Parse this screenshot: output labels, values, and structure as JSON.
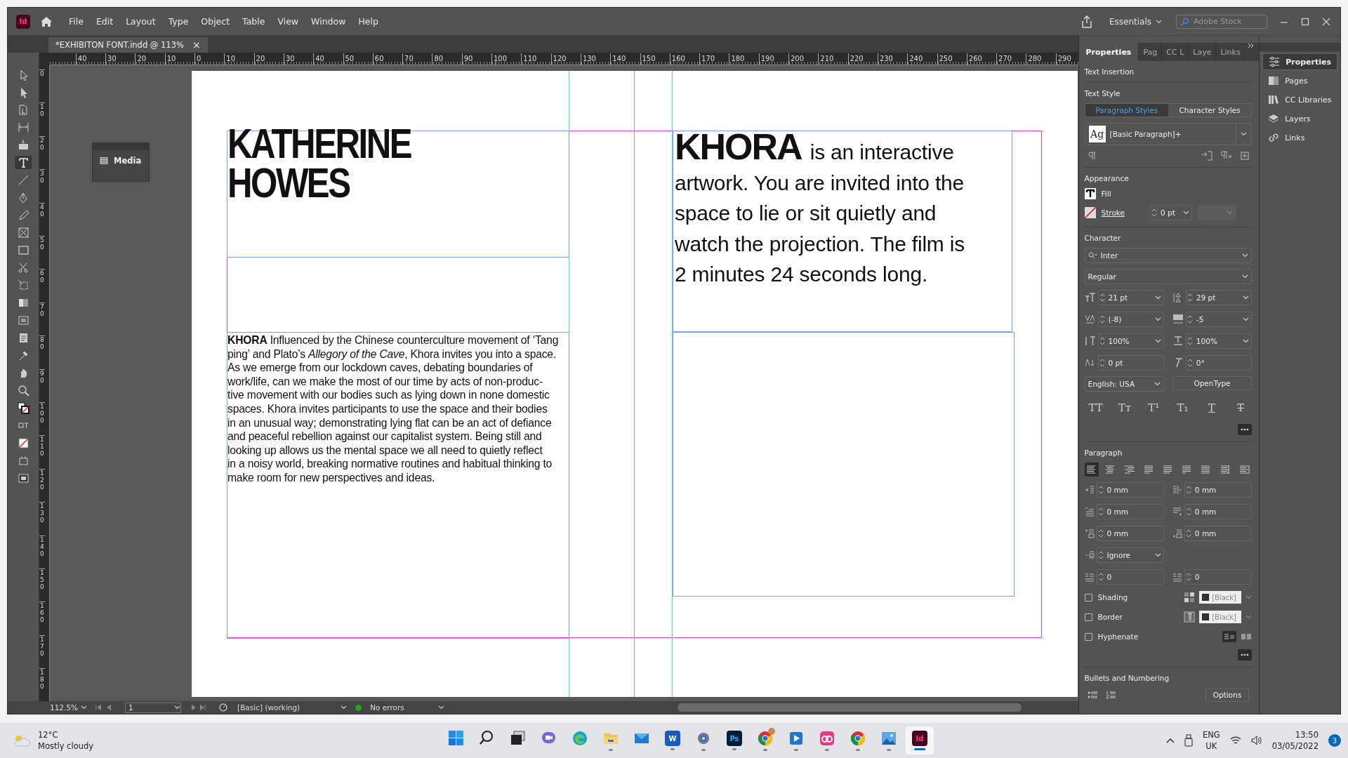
{
  "window": {
    "app_logo": "Id",
    "menu": [
      "File",
      "Edit",
      "Layout",
      "Type",
      "Object",
      "Table",
      "View",
      "Window",
      "Help"
    ],
    "workspace": "Essentials",
    "search": {
      "placeholder": "Adobe Stock"
    }
  },
  "document_tab": {
    "title": "*EXHIBITON FONT.indd @ 113%",
    "close": "×"
  },
  "horizontal_ruler": [
    "40",
    "30",
    "20",
    "10",
    "0",
    "10",
    "20",
    "30",
    "40",
    "50",
    "60",
    "70",
    "80",
    "90",
    "100",
    "110",
    "120",
    "130",
    "140",
    "150",
    "160",
    "170",
    "180",
    "190",
    "200",
    "210",
    "220",
    "230",
    "240",
    "250",
    "260",
    "270",
    "280",
    "290"
  ],
  "vertical_ruler": [
    "0",
    "10",
    "20",
    "30",
    "40",
    "50",
    "60",
    "70",
    "80",
    "90",
    "100",
    "110",
    "120",
    "130",
    "140",
    "150",
    "160",
    "170",
    "180"
  ],
  "tools": [
    {
      "kind": "selection",
      "selected": false
    },
    {
      "kind": "direct",
      "selected": false
    },
    {
      "kind": "page",
      "selected": false
    },
    {
      "kind": "gap",
      "selected": false
    },
    {
      "kind": "collector",
      "selected": false
    },
    {
      "kind": "type",
      "selected": true
    },
    {
      "kind": "line",
      "selected": false
    },
    {
      "kind": "pen",
      "selected": false
    },
    {
      "kind": "pencil",
      "selected": false
    },
    {
      "kind": "frame",
      "selected": false
    },
    {
      "kind": "rect",
      "selected": false
    },
    {
      "kind": "scissors",
      "selected": false
    },
    {
      "kind": "transform",
      "selected": false
    },
    {
      "kind": "gradient",
      "selected": false
    },
    {
      "kind": "feather",
      "selected": false
    },
    {
      "kind": "note",
      "selected": false
    },
    {
      "kind": "eyedropper",
      "selected": false
    },
    {
      "kind": "hand",
      "selected": false
    },
    {
      "kind": "zoom",
      "selected": false
    },
    {
      "kind": "fillstroke",
      "selected": false
    },
    {
      "kind": "format",
      "selected": false
    },
    {
      "kind": "none",
      "selected": false
    },
    {
      "kind": "view",
      "selected": false
    },
    {
      "kind": "screen",
      "selected": false
    }
  ],
  "media_panel": {
    "title": "Media"
  },
  "page": {
    "left_heading": [
      "KATHERINE",
      "HOWES"
    ],
    "left_body": [
      "**KHORA** Influenced by the Chinese counterculture movement of ‘Tang",
      "ping’ and Plato’s *Allegory of the Cave*, Khora invites you into a space.",
      "As we emerge from our lockdown caves, debating boundaries of",
      "work/life, can we make the most of our time by acts of non-produc-",
      "tive movement with our bodies such as lying down in none domestic",
      "spaces. Khora invites participants to use the space and their bodies",
      "in an unusual way; demonstrating lying flat can be an act of defiance",
      "and peaceful rebellion against our capitalist system. Being still and",
      "looking up allows us the mental space we all need to quietly reflect",
      "in a noisy world, breaking normative routines and habitual thinking to",
      "make room for new perspectives and ideas."
    ],
    "right_lead": "KHORA",
    "right_lines": [
      "is an interactive",
      "artwork. You are invited into the",
      "space to lie or sit quietly and",
      "watch the projection. The film is",
      "2 minutes 24 seconds long."
    ]
  },
  "panel_tabs": [
    {
      "label": "Properties",
      "selected": true
    },
    {
      "label": "Pag",
      "selected": false
    },
    {
      "label": "CC L",
      "selected": false
    },
    {
      "label": "Laye",
      "selected": false
    },
    {
      "label": "Links",
      "selected": false
    }
  ],
  "properties": {
    "context": "Text Insertion",
    "text_style": {
      "heading": "Text Style",
      "tabs": [
        {
          "label": "Paragraph Styles",
          "selected": true
        },
        {
          "label": "Character Styles",
          "selected": false
        }
      ],
      "style_preview": "Ag",
      "style": "[Basic Paragraph]+"
    },
    "appearance": {
      "heading": "Appearance",
      "fill": "Fill",
      "stroke": "Stroke",
      "stroke_weight": "0 pt"
    },
    "character": {
      "heading": "Character",
      "font": "Inter",
      "style": "Regular",
      "fields": [
        {
          "kind": "size",
          "value": "21 pt"
        },
        {
          "kind": "leading",
          "value": "29 pt"
        },
        {
          "kind": "kerning",
          "value": "(-8)"
        },
        {
          "kind": "tracking",
          "value": "-5"
        },
        {
          "kind": "vscale",
          "value": "100%"
        },
        {
          "kind": "hscale",
          "value": "100%"
        },
        {
          "kind": "baseline",
          "value": "0 pt"
        },
        {
          "kind": "skew",
          "value": "0°"
        }
      ],
      "language": "English: USA",
      "opentype": "OpenType",
      "type_buttons": [
        {
          "label": "TT",
          "kind": "plain"
        },
        {
          "label": "Tᴛ",
          "kind": "plain"
        },
        {
          "label": "T¹",
          "kind": "plain"
        },
        {
          "label": "T₁",
          "kind": "plain"
        },
        {
          "label": "T",
          "kind": "underline"
        },
        {
          "label": "T",
          "kind": "strike"
        }
      ]
    },
    "paragraph": {
      "heading": "Paragraph",
      "alignments": [
        {
          "selected": true
        },
        {
          "selected": false
        },
        {
          "selected": false
        },
        {
          "selected": false
        },
        {
          "selected": false
        },
        {
          "selected": false
        },
        {
          "selected": false
        },
        {
          "selected": false
        },
        {
          "selected": false
        }
      ],
      "fields": [
        {
          "kind": "left-indent",
          "value": "0 mm"
        },
        {
          "kind": "right-indent",
          "value": "0 mm"
        },
        {
          "kind": "first-indent",
          "value": "0 mm"
        },
        {
          "kind": "last-indent",
          "value": "0 mm"
        },
        {
          "kind": "space-before",
          "value": "0 mm"
        },
        {
          "kind": "space-after",
          "value": "0 mm"
        }
      ],
      "grid_align": "Ignore",
      "drop_lines": "0",
      "drop_chars": "0",
      "options": [
        {
          "label": "Shading",
          "checked": false,
          "swatch": "[Black]"
        },
        {
          "label": "Border",
          "checked": false,
          "swatch": "[Black]"
        },
        {
          "label": "Hyphenate",
          "checked": false
        }
      ]
    },
    "bullets": {
      "heading": "Bullets and Numbering",
      "options_button": "Options"
    }
  },
  "dock": [
    {
      "kind": "properties",
      "label": "Properties",
      "selected": true
    },
    {
      "kind": "pages",
      "label": "Pages",
      "selected": false
    },
    {
      "kind": "libraries",
      "label": "CC Libraries",
      "selected": false
    },
    {
      "kind": "layers",
      "label": "Layers",
      "selected": false
    },
    {
      "kind": "links",
      "label": "Links",
      "selected": false
    }
  ],
  "status_bar": {
    "zoom": "112.5%",
    "page": "1",
    "profile": "[Basic] (working)",
    "errors": false,
    "preflight": "No errors"
  },
  "taskbar": {
    "weather": {
      "temp": "12°C",
      "condition": "Mostly cloudy"
    },
    "apps": [
      {
        "kind": "start",
        "running": false,
        "active": false
      },
      {
        "kind": "search",
        "running": false,
        "active": false
      },
      {
        "kind": "taskview",
        "running": false,
        "active": false
      },
      {
        "kind": "chat",
        "running": false,
        "active": false
      },
      {
        "kind": "edge",
        "running": false,
        "active": false
      },
      {
        "kind": "explorer",
        "running": true,
        "active": false
      },
      {
        "kind": "mail",
        "running": false,
        "active": false
      },
      {
        "kind": "word",
        "label": "W",
        "running": true,
        "active": false
      },
      {
        "kind": "settings",
        "running": true,
        "active": false
      },
      {
        "kind": "photoshop",
        "label": "Ps",
        "running": true,
        "active": false
      },
      {
        "kind": "chrome",
        "running": true,
        "active": false,
        "avatar": true
      },
      {
        "kind": "media",
        "running": true,
        "active": false
      },
      {
        "kind": "cloud",
        "running": true,
        "active": false
      },
      {
        "kind": "chrome",
        "running": true,
        "active": false
      },
      {
        "kind": "photos",
        "running": true,
        "active": false
      },
      {
        "kind": "indesign",
        "label": "Id",
        "running": true,
        "active": true
      }
    ],
    "tray": {
      "language": "ENG",
      "region": "UK",
      "time": "13:50",
      "date": "03/05/2022",
      "notifications": "3"
    }
  }
}
